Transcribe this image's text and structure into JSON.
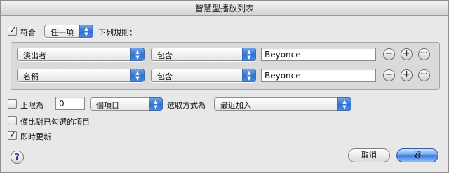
{
  "window": {
    "title": "智慧型播放列表"
  },
  "match": {
    "label_prefix": "符合",
    "mode_value": "任一項",
    "label_suffix": "下列規則："
  },
  "rules": [
    {
      "field": "演出者",
      "operator": "包含",
      "value": "Beyonce"
    },
    {
      "field": "名稱",
      "operator": "包含",
      "value": "Beyonce"
    }
  ],
  "rule_buttons": {
    "remove": "−",
    "add": "+",
    "more": "···"
  },
  "limit": {
    "label": "上限為",
    "value": "0",
    "unit": "個項目",
    "selected_by_label": "選取方式為",
    "selected_by": "最近加入"
  },
  "checked_only": {
    "label": "僅比對已勾選的項目"
  },
  "live_update": {
    "label": "即時更新"
  },
  "buttons": {
    "help": "?",
    "cancel": "取消",
    "ok": "好"
  },
  "colors": {
    "accent": "#3b7be0",
    "window_bg": "#e8e8e8"
  }
}
